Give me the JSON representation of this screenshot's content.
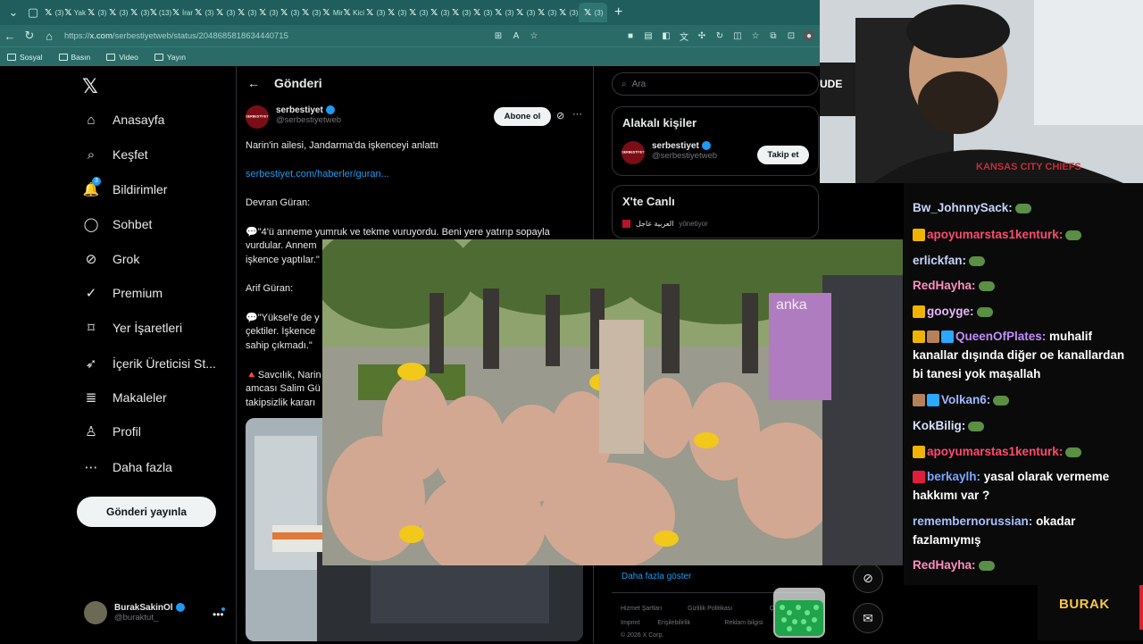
{
  "browser": {
    "tabs": [
      "(3)",
      "Yak",
      "(3)",
      "(3)",
      "(3)",
      "(13)",
      "İrar",
      "(3)",
      "(3)",
      "(3)",
      "(3)",
      "(3)",
      "(3)",
      "Mir",
      "Kici",
      "(3)",
      "(3)",
      "(3)",
      "(3)",
      "(3)",
      "(3)",
      "(3)",
      "(3)",
      "(3)",
      "(3)",
      "(3)"
    ],
    "url_prefix": "https://",
    "url_host": "x.com",
    "url_path": "/serbestiyetweb/status/2048685818634440715",
    "bookmarks": [
      "Sosyal",
      "Basın",
      "Video",
      "Yayın"
    ]
  },
  "x": {
    "nav": [
      {
        "label": "Anasayfa",
        "icon": "home-icon"
      },
      {
        "label": "Keşfet",
        "icon": "search-icon"
      },
      {
        "label": "Bildirimler",
        "icon": "bell-icon",
        "badge": "3"
      },
      {
        "label": "Sohbet",
        "icon": "chat-icon"
      },
      {
        "label": "Grok",
        "icon": "grok-icon"
      },
      {
        "label": "Premium",
        "icon": "premium-icon"
      },
      {
        "label": "Yer İşaretleri",
        "icon": "bookmark-icon"
      },
      {
        "label": "İçerik Üreticisi St...",
        "icon": "rocket-icon"
      },
      {
        "label": "Makaleler",
        "icon": "article-icon"
      },
      {
        "label": "Profil",
        "icon": "person-icon"
      },
      {
        "label": "Daha fazla",
        "icon": "more-icon"
      }
    ],
    "post_button": "Gönderi yayınla",
    "account": {
      "name": "BurakSakinOl",
      "handle": "@buraktut_"
    },
    "header_title": "Gönderi",
    "post": {
      "author_name": "serbestiyet",
      "author_handle": "@serbestiyetweb",
      "avatar_text": "SERBESTİYET",
      "follow_label": "Abone ol",
      "lines": [
        "Narin'in ailesi, Jandarma'da işkenceyi anlattı",
        "serbestiyet.com/haberler/guran...",
        "Devran Güran:",
        "💬\"4'ü anneme yumruk ve tekme vuruyordu. Beni yere yatırıp sopayla",
        "vurdular. Annem",
        "işkence yaptılar.\"",
        "Arif Güran:",
        "💬\"Yüksel'e de y",
        "çektiler. İşkence",
        "sahip çıkmadı.\"",
        "🔺Savcılık, Narin",
        "amcası Salim Gü",
        "takipsizlik kararı"
      ]
    },
    "search_placeholder": "Ara",
    "related": {
      "title": "Alakalı kişiler",
      "name": "serbestiyet",
      "handle": "@serbestiyetweb",
      "follow_label": "Takip et"
    },
    "live": {
      "title": "X'te Canlı",
      "host": "العربية عاجل",
      "status": "yönetiyor"
    },
    "show_more": "Daha fazla göster",
    "footer": {
      "row1": [
        "Hizmet Şartları",
        "Gizlilik Politikası",
        "Çerez Pol"
      ],
      "row2": [
        "Imprint",
        "Erişilebilirlik",
        "Reklam bilgisi",
        "Dah"
      ],
      "row3": "© 2026 X Corp."
    }
  },
  "video": {
    "watermark": "anka"
  },
  "webcam": {
    "shirt_text": "KANSAS CITY CHIEFS",
    "banner": "UDE"
  },
  "chat": [
    {
      "user": "Bw_JohnnySack:",
      "color": "#c8d6ff",
      "text": "",
      "emote": true
    },
    {
      "user": "apoyumarstas1kenturk:",
      "color": "#ff4b6e",
      "text": "",
      "emote": true,
      "badges": [
        "#f0b400"
      ]
    },
    {
      "user": "erlickfan:",
      "color": "#c8d6ff",
      "text": "",
      "emote": true
    },
    {
      "user": "RedHayha:",
      "color": "#ff8fbf",
      "text": "",
      "emote": true
    },
    {
      "user": "gooyge:",
      "color": "#e8b6ff",
      "text": "",
      "emote": true,
      "badges": [
        "#f0b400"
      ]
    },
    {
      "user": "QueenOfPlates:",
      "color": "#c38cff",
      "text": "muhalif kanallar dışında diğer oe kanallardan bi tanesi yok maşallah",
      "badges": [
        "#f0b400",
        "#b5815a",
        "#2aa7ff"
      ]
    },
    {
      "user": "Volkan6:",
      "color": "#9fb9ff",
      "text": "",
      "emote": true,
      "badges": [
        "#b5815a",
        "#2aa7ff"
      ]
    },
    {
      "user": "KokBilig:",
      "color": "#d6e0ff",
      "text": "",
      "emote": true
    },
    {
      "user": "apoyumarstas1kenturk:",
      "color": "#ff4b6e",
      "text": "",
      "emote": true,
      "badges": [
        "#f0b400"
      ]
    },
    {
      "user": "berkaylh:",
      "color": "#7aa7ff",
      "text": "yasal olarak vermeme hakkımı var ?",
      "badges": [
        "#e01e3c"
      ]
    },
    {
      "user": "remembernorussian:",
      "color": "#a8c0ff",
      "text": "okadar fazlamıymış"
    },
    {
      "user": "RedHayha:",
      "color": "#ff8fbf",
      "text": "",
      "emote": true
    }
  ],
  "overlay_brand": "BURAK"
}
